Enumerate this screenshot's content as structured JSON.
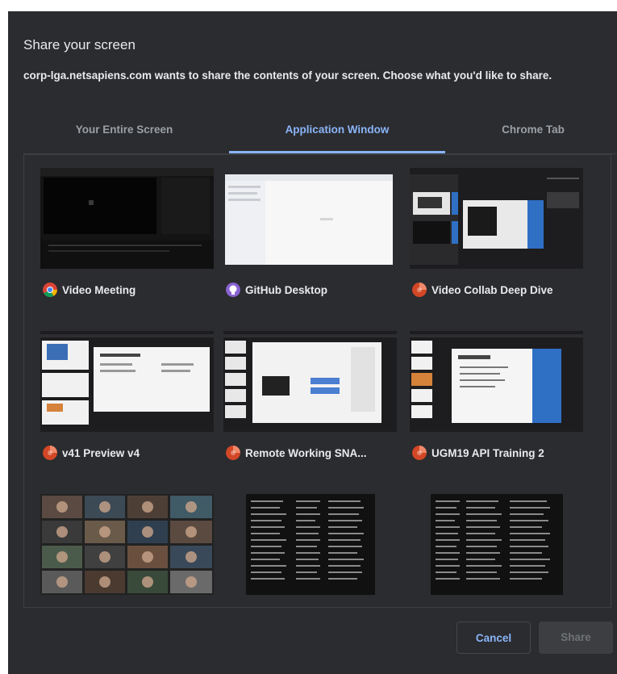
{
  "dialog": {
    "title": "Share your screen",
    "description": "corp-lga.netsapiens.com wants to share the contents of your screen. Choose what you'd like to share."
  },
  "tabs": [
    {
      "label": "Your Entire Screen",
      "selected": false
    },
    {
      "label": "Application Window",
      "selected": true
    },
    {
      "label": "Chrome Tab",
      "selected": false
    }
  ],
  "windows": [
    {
      "label": "Video Meeting",
      "icon": "chrome-icon"
    },
    {
      "label": "GitHub Desktop",
      "icon": "github-desktop-icon"
    },
    {
      "label": "Video Collab Deep Dive",
      "icon": "powerpoint-icon"
    },
    {
      "label": "v41 Preview v4",
      "icon": "powerpoint-icon"
    },
    {
      "label": "Remote Working SNA...",
      "icon": "powerpoint-icon"
    },
    {
      "label": "UGM19 API Training 2",
      "icon": "powerpoint-icon"
    },
    {
      "label": "",
      "icon": ""
    },
    {
      "label": "",
      "icon": ""
    },
    {
      "label": "",
      "icon": ""
    }
  ],
  "buttons": {
    "cancel": "Cancel",
    "share": "Share"
  },
  "colors": {
    "dialog_bg": "#2b2c2f",
    "accent": "#8ab4f8",
    "text": "#e8eaed",
    "muted": "#9aa0a6"
  }
}
